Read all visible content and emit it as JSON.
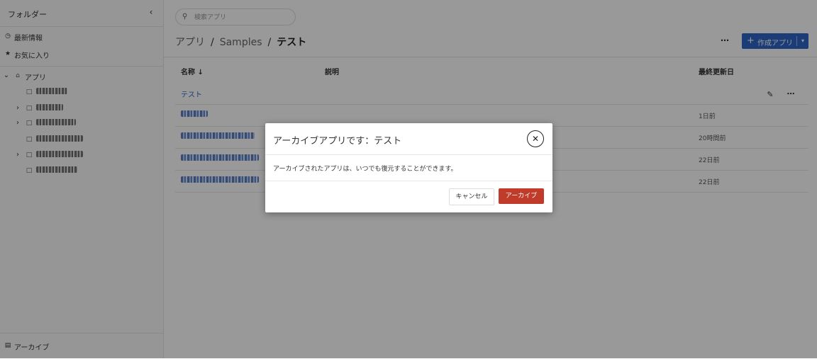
{
  "sidebar": {
    "title": "フォルダー",
    "collapse_icon": "chevron-left-icon",
    "recent_label": "最新情報",
    "favorites_label": "お気に入り",
    "apps_label": "アプリ",
    "archive_label": "アーカイブ"
  },
  "search": {
    "placeholder": "検索アプリ",
    "value": ""
  },
  "breadcrumb": {
    "root": "アプリ",
    "middle": "Samples",
    "current": "テスト",
    "separator": "/"
  },
  "header": {
    "more_label": "⋯",
    "create_label": "作成アプリ"
  },
  "table": {
    "columns": {
      "name": "名称",
      "description": "説明",
      "modified": "最終更新日"
    },
    "sort_indicator": "↓",
    "rows": [
      {
        "name": "テスト",
        "modified": ""
      },
      {
        "name": "",
        "modified": "1日前"
      },
      {
        "name": "",
        "modified": "20時間前"
      },
      {
        "name": "",
        "modified": "22日前"
      },
      {
        "name": "",
        "modified": "22日前"
      }
    ]
  },
  "dialog": {
    "title": "アーカイブアプリです：テスト",
    "body": "アーカイブされたアプリは、いつでも復元することができます。",
    "cancel_label": "キャンセル",
    "confirm_label": "アーカイブ",
    "confirm_color": "#c13b2a"
  },
  "colors": {
    "accent": "#2f64c9",
    "link": "#2f64c9",
    "danger": "#c13b2a"
  }
}
